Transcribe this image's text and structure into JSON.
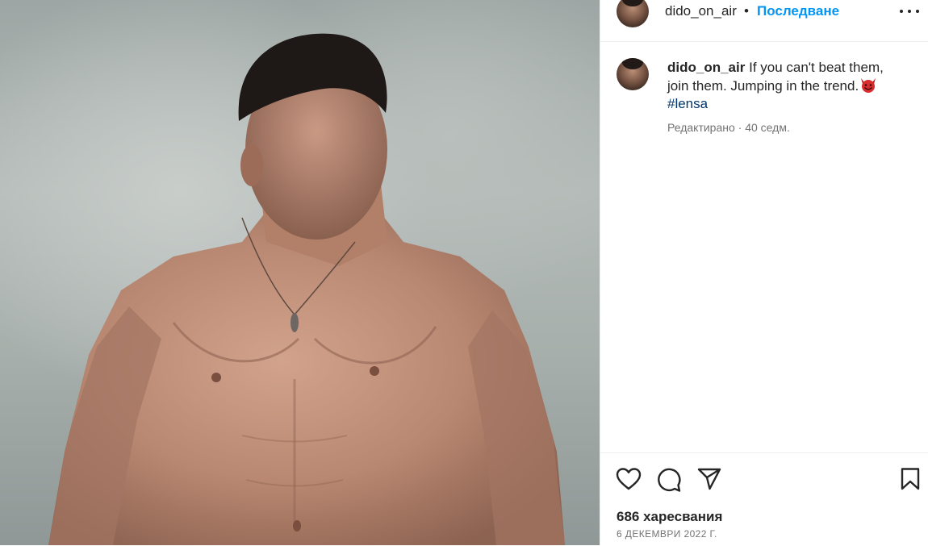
{
  "post": {
    "image_alt": "shirtless man looking down against a grey sky",
    "author": "dido_on_air",
    "separator": "•",
    "follow_label": "Последване",
    "caption_text": "If you can't beat them, join them. Jumping in the trend.",
    "caption_emoji_icon": "smiling-devil-emoji-icon",
    "hashtag": "#lensa",
    "edited_label": "Редактирано",
    "meta_sep": " · ",
    "age": "40 седм.",
    "likes_text": "686 харесвания",
    "date_text": "6 ДЕКЕМВРИ 2022 Г."
  },
  "icons": {
    "more": "more-options-icon",
    "like": "heart-icon",
    "comment": "comment-icon",
    "share": "send-icon",
    "save": "bookmark-icon"
  },
  "colors": {
    "accent": "#0095f6",
    "hashtag": "#00376b",
    "text": "#262626",
    "secondary": "#737373",
    "divider": "#efefef"
  }
}
